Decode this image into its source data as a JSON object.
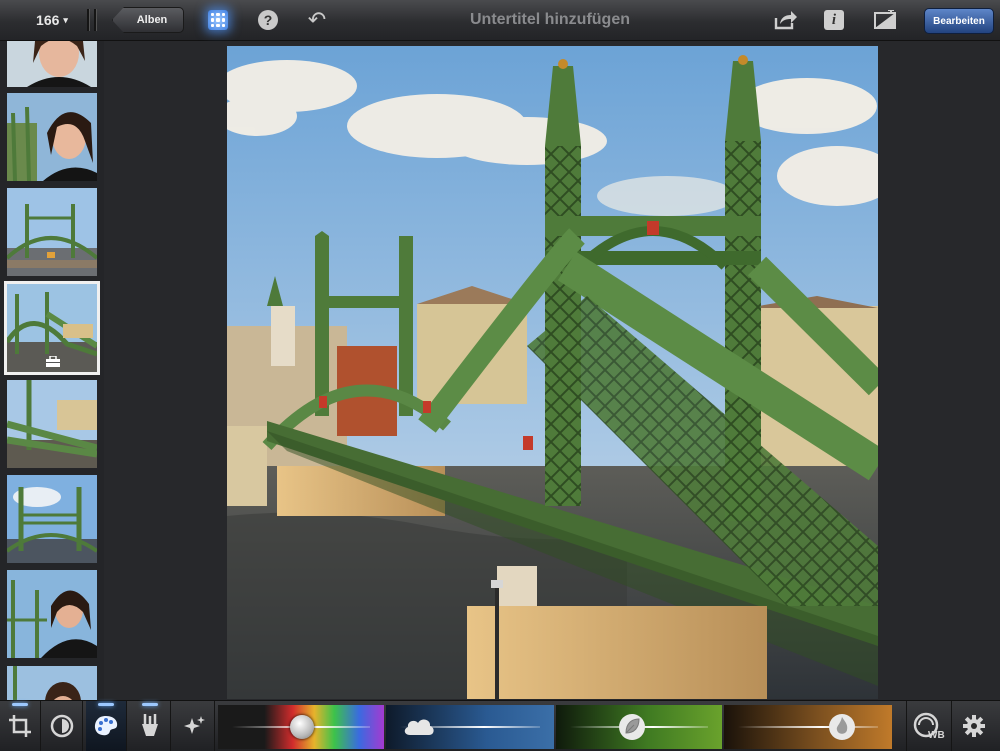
{
  "topbar": {
    "photo_count": "166",
    "count_caret": "▾",
    "back_label": "Alben",
    "title_placeholder": "Untertitel hinzufügen",
    "edit_label": "Bearbeiten",
    "help_glyph": "?",
    "info_glyph": "i",
    "undo_glyph": "↶"
  },
  "icons": [
    "photo-count-dropdown",
    "grid-icon",
    "help-icon",
    "undo-icon",
    "share-icon",
    "info-icon",
    "compare-icon",
    "crop-icon",
    "exposure-icon",
    "color-palette-icon",
    "brushes-icon",
    "effects-icon",
    "white-balance-icon",
    "gear-icon"
  ],
  "thumbnails": [
    {
      "subject": "portrait"
    },
    {
      "subject": "portrait"
    },
    {
      "subject": "bridge"
    },
    {
      "subject": "bridge",
      "selected": true
    },
    {
      "subject": "bridge"
    },
    {
      "subject": "bridge"
    },
    {
      "subject": "portrait"
    },
    {
      "subject": "portrait"
    }
  ],
  "bottombar": {
    "wb_label": "WB",
    "sliders": [
      {
        "name": "saturation",
        "level": 0.5
      },
      {
        "name": "sky",
        "level": 0.2
      },
      {
        "name": "foliage",
        "level": 0.55
      },
      {
        "name": "skin",
        "level": 0.65
      }
    ]
  },
  "colors": {
    "accent": "#3f7fe0",
    "edit_button": "#2c4f8f",
    "bridge_green": "#4e7a3a"
  }
}
